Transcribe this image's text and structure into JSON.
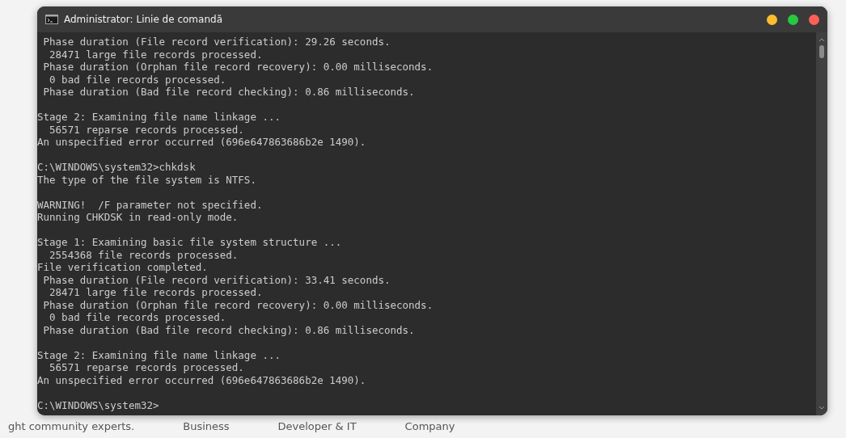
{
  "window": {
    "title": "Administrator: Linie de comandă"
  },
  "console": {
    "blocks": [
      [
        " Phase duration (File record verification): 29.26 seconds.",
        "  28471 large file records processed.",
        " Phase duration (Orphan file record recovery): 0.00 milliseconds.",
        "  0 bad file records processed.",
        " Phase duration (Bad file record checking): 0.86 milliseconds."
      ],
      [
        "Stage 2: Examining file name linkage ...",
        "  56571 reparse records processed.",
        "An unspecified error occurred (696e647863686b2e 1490)."
      ],
      [
        "C:\\WINDOWS\\system32>chkdsk",
        "The type of the file system is NTFS."
      ],
      [
        "WARNING!  /F parameter not specified.",
        "Running CHKDSK in read-only mode."
      ],
      [
        "Stage 1: Examining basic file system structure ...",
        "  2554368 file records processed.",
        "File verification completed.",
        " Phase duration (File record verification): 33.41 seconds.",
        "  28471 large file records processed.",
        " Phase duration (Orphan file record recovery): 0.00 milliseconds.",
        "  0 bad file records processed.",
        " Phase duration (Bad file record checking): 0.86 milliseconds."
      ],
      [
        "Stage 2: Examining file name linkage ...",
        "  56571 reparse records processed.",
        "An unspecified error occurred (696e647863686b2e 1490)."
      ],
      [
        "C:\\WINDOWS\\system32>"
      ]
    ]
  },
  "background_page": {
    "texts": [
      "ght community experts.",
      "Business",
      "Developer & IT",
      "Company"
    ]
  }
}
